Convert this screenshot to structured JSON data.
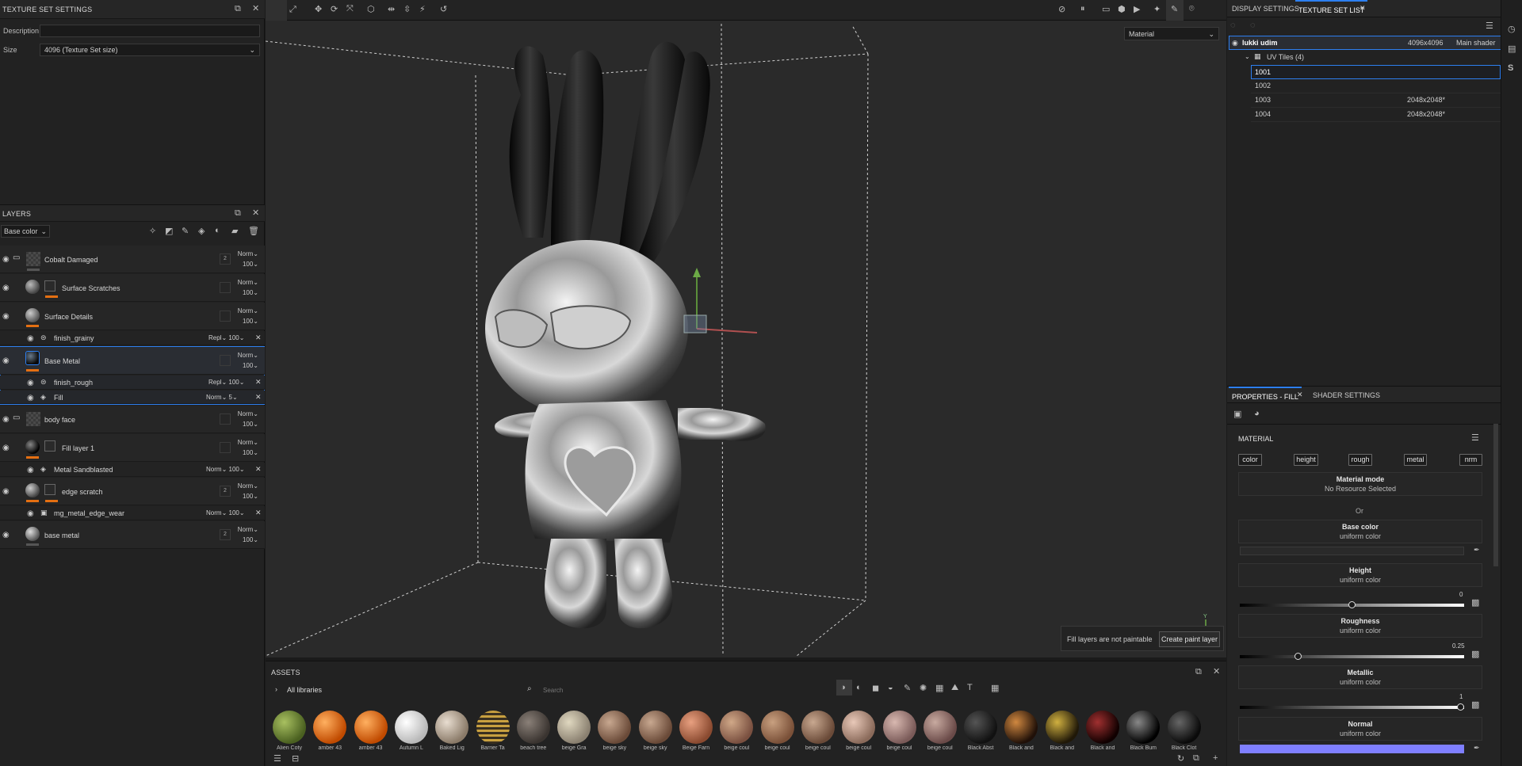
{
  "texture_set_settings": {
    "title": "TEXTURE SET SETTINGS",
    "description_label": "Description",
    "description_value": "",
    "size_label": "Size",
    "size_value": "4096 (Texture Set size)"
  },
  "layers": {
    "title": "LAYERS",
    "channel": "Base color",
    "rows": [
      {
        "name": "Cobalt Damaged",
        "blend": "Norm",
        "opacity": "100",
        "badge": "2"
      },
      {
        "name": "Surface Scratches",
        "blend": "Norm",
        "opacity": "100"
      },
      {
        "name": "Surface Details",
        "blend": "Norm",
        "opacity": "100"
      },
      {
        "name": "finish_grainy",
        "blend": "Repl",
        "opacity": "100"
      },
      {
        "name": "Base Metal",
        "blend": "Norm",
        "opacity": "100"
      },
      {
        "name": "finish_rough",
        "blend": "Repl",
        "opacity": "100"
      },
      {
        "name": "Fill",
        "blend": "Norm",
        "opacity": "5"
      },
      {
        "name": "body face",
        "blend": "Norm",
        "opacity": "100"
      },
      {
        "name": "Fill layer 1",
        "blend": "Norm",
        "opacity": "100"
      },
      {
        "name": "Metal Sandblasted",
        "blend": "Norm",
        "opacity": "100"
      },
      {
        "name": "edge scratch",
        "blend": "Norm",
        "opacity": "100",
        "badge": "2"
      },
      {
        "name": "mg_metal_edge_wear",
        "blend": "Norm",
        "opacity": "100"
      },
      {
        "name": "base metal",
        "blend": "Norm",
        "opacity": "100",
        "badge": "2"
      }
    ]
  },
  "viewport": {
    "mode_select": "Material",
    "notice_text": "Fill layers are not paintable",
    "create_paint_layer": "Create paint layer",
    "axis_label": "Y"
  },
  "assets": {
    "title": "ASSETS",
    "library": "All libraries",
    "search_placeholder": "Search",
    "items": [
      "Alien Coty",
      "amber 43",
      "amber 43",
      "Autumn L",
      "Baked Lig",
      "Barrier Ta",
      "beach tree",
      "beige Gra",
      "beige sky",
      "beige sky",
      "Beige Farn",
      "beige coul",
      "beige coul",
      "beige coul",
      "beige coul",
      "beige coul",
      "beige coul",
      "Black Abst",
      "Black and",
      "Black and",
      "Black and",
      "Black Bum",
      "Black Clot"
    ]
  },
  "texture_set_list": {
    "tab_display": "DISPLAY SETTINGS",
    "tab_list": "TEXTURE SET LIST",
    "set_name": "lukki udim",
    "set_size": "4096x4096",
    "set_shader": "Main shader",
    "uv_tiles": "UV Tiles (4)",
    "tiles": [
      {
        "id": "1001",
        "size": ""
      },
      {
        "id": "1002",
        "size": ""
      },
      {
        "id": "1003",
        "size": "2048x2048*"
      },
      {
        "id": "1004",
        "size": "2048x2048*"
      }
    ]
  },
  "properties": {
    "tab_fill": "PROPERTIES - FILL",
    "tab_shader": "SHADER SETTINGS",
    "material_title": "MATERIAL",
    "chips": [
      "color",
      "height",
      "rough",
      "metal",
      "nrm"
    ],
    "material_mode": "Material mode",
    "no_resource": "No Resource Selected",
    "or": "Or",
    "base_color": "Base color",
    "height": "Height",
    "roughness": "Roughness",
    "metallic": "Metallic",
    "normal": "Normal",
    "uniform_color": "uniform color",
    "height_value": "0",
    "roughness_value": "0.25",
    "metallic_value": "1",
    "height_fraction": 0.5,
    "roughness_fraction": 0.25,
    "metallic_fraction": 1.0,
    "normal_color": "#7f7fff"
  }
}
